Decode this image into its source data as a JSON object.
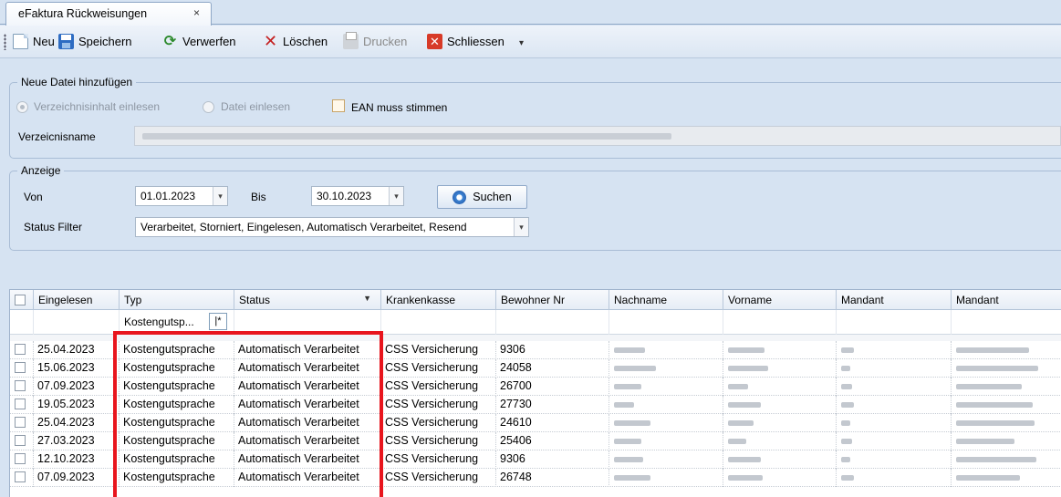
{
  "tab": {
    "title": "eFaktura Rückweisungen",
    "close_glyph": "×"
  },
  "toolbar": {
    "new_label": "Neu",
    "save_label": "Speichern",
    "discard_label": "Verwerfen",
    "delete_label": "Löschen",
    "print_label": "Drucken",
    "close_label": "Schliessen",
    "overflow_glyph": "▾"
  },
  "add_file": {
    "legend": "Neue Datei hinzufügen",
    "radio_directory": "Verzeichnisinhalt einlesen",
    "radio_file": "Datei einlesen",
    "ean_check": "EAN muss stimmen",
    "directory_label": "Verzeicnisname"
  },
  "display": {
    "legend": "Anzeige",
    "from_label": "Von",
    "from_value": "01.01.2023",
    "to_label": "Bis",
    "to_value": "30.10.2023",
    "search_label": "Suchen",
    "status_filter_label": "Status Filter",
    "status_filter_value": "Verarbeitet, Storniert, Eingelesen, Automatisch Verarbeitet, Resend"
  },
  "grid": {
    "columns": [
      "Eingelesen",
      "Typ",
      "Status",
      "Krankenkasse",
      "Bewohner Nr",
      "Nachname",
      "Vorname",
      "Mandant",
      "Mandant"
    ],
    "filter_typ": "Kostengutsp...",
    "filter_op": "|*",
    "rows": [
      {
        "eingelesen": "25.04.2023",
        "typ": "Kostengutsprache",
        "status": "Automatisch Verarbeitet",
        "kasse": "CSS Versicherung",
        "bewohner": "9306"
      },
      {
        "eingelesen": "15.06.2023",
        "typ": "Kostengutsprache",
        "status": "Automatisch Verarbeitet",
        "kasse": "CSS Versicherung",
        "bewohner": "24058"
      },
      {
        "eingelesen": "07.09.2023",
        "typ": "Kostengutsprache",
        "status": "Automatisch Verarbeitet",
        "kasse": "CSS Versicherung",
        "bewohner": "26700"
      },
      {
        "eingelesen": "19.05.2023",
        "typ": "Kostengutsprache",
        "status": "Automatisch Verarbeitet",
        "kasse": "CSS Versicherung",
        "bewohner": "27730"
      },
      {
        "eingelesen": "25.04.2023",
        "typ": "Kostengutsprache",
        "status": "Automatisch Verarbeitet",
        "kasse": "CSS Versicherung",
        "bewohner": "24610"
      },
      {
        "eingelesen": "27.03.2023",
        "typ": "Kostengutsprache",
        "status": "Automatisch Verarbeitet",
        "kasse": "CSS Versicherung",
        "bewohner": "25406"
      },
      {
        "eingelesen": "12.10.2023",
        "typ": "Kostengutsprache",
        "status": "Automatisch Verarbeitet",
        "kasse": "CSS Versicherung",
        "bewohner": "9306"
      },
      {
        "eingelesen": "07.09.2023",
        "typ": "Kostengutsprache",
        "status": "Automatisch Verarbeitet",
        "kasse": "CSS Versicherung",
        "bewohner": "26748"
      }
    ]
  },
  "colors": {
    "highlight": "#e8151d",
    "background": "#d6e3f2"
  }
}
